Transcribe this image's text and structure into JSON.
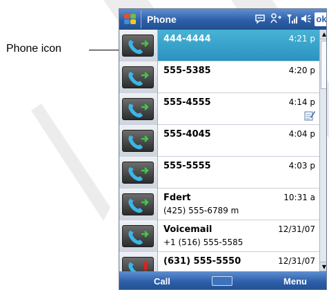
{
  "callout": {
    "label": "Phone icon"
  },
  "titlebar": {
    "app_title": "Phone",
    "ok_label": "ok",
    "icons": [
      "start-icon",
      "message-icon",
      "connectivity-icon",
      "signal-icon",
      "volume-icon"
    ]
  },
  "calls": [
    {
      "name": "444-4444",
      "time": "4:21 p",
      "sub": "",
      "selected": true,
      "type": "outgoing"
    },
    {
      "name": "555-5385",
      "time": "4:20 p",
      "sub": "",
      "selected": false,
      "type": "outgoing"
    },
    {
      "name": "555-4555",
      "time": "4:14 p",
      "sub": "",
      "selected": false,
      "type": "outgoing",
      "note": true
    },
    {
      "name": "555-4045",
      "time": "4:04 p",
      "sub": "",
      "selected": false,
      "type": "outgoing"
    },
    {
      "name": "555-5555",
      "time": "4:03 p",
      "sub": "",
      "selected": false,
      "type": "outgoing"
    },
    {
      "name": "Fdert",
      "time": "10:31 a",
      "sub": "(425) 555-6789 m",
      "selected": false,
      "type": "outgoing"
    },
    {
      "name": "Voicemail",
      "time": "12/31/07",
      "sub": "+1 (516) 555-5585",
      "selected": false,
      "type": "outgoing"
    },
    {
      "name": "(631) 555-5550",
      "time": "12/31/07",
      "sub": "",
      "selected": false,
      "type": "missed"
    }
  ],
  "softkeys": {
    "left": "Call",
    "right": "Menu"
  },
  "colors": {
    "titlebar": "#2d5ea8",
    "selected_row": "#2a92c0",
    "phone_handset": "#3ab6e6",
    "outgoing_arrow": "#3fc84a",
    "missed_mark": "#e02020"
  }
}
